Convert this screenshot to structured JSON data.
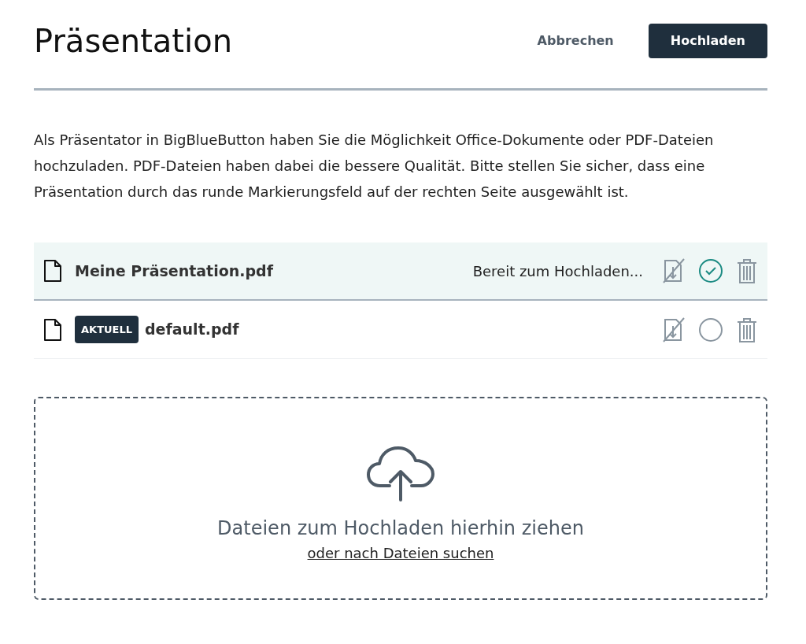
{
  "header": {
    "title": "Präsentation",
    "cancel_label": "Abbrechen",
    "confirm_label": "Hochladen"
  },
  "intro": "Als Präsentator in BigBlueButton haben Sie die Möglichkeit Office-Dokumente oder PDF-Dateien hochzuladen. PDF-Dateien haben dabei die bessere Qualität. Bitte stellen Sie sicher, dass eine Präsentation durch das runde Markierungsfeld auf der rechten Seite ausgewählt ist.",
  "files": [
    {
      "name": "Meine Präsentation.pdf",
      "status": "Bereit zum Hochladen...",
      "selected": true
    },
    {
      "name": "default.pdf",
      "badge": "AKTUELL",
      "selected": false
    }
  ],
  "dropzone": {
    "message": "Dateien zum Hochladen hierhin ziehen",
    "browse_link": "oder nach Dateien suchen"
  }
}
